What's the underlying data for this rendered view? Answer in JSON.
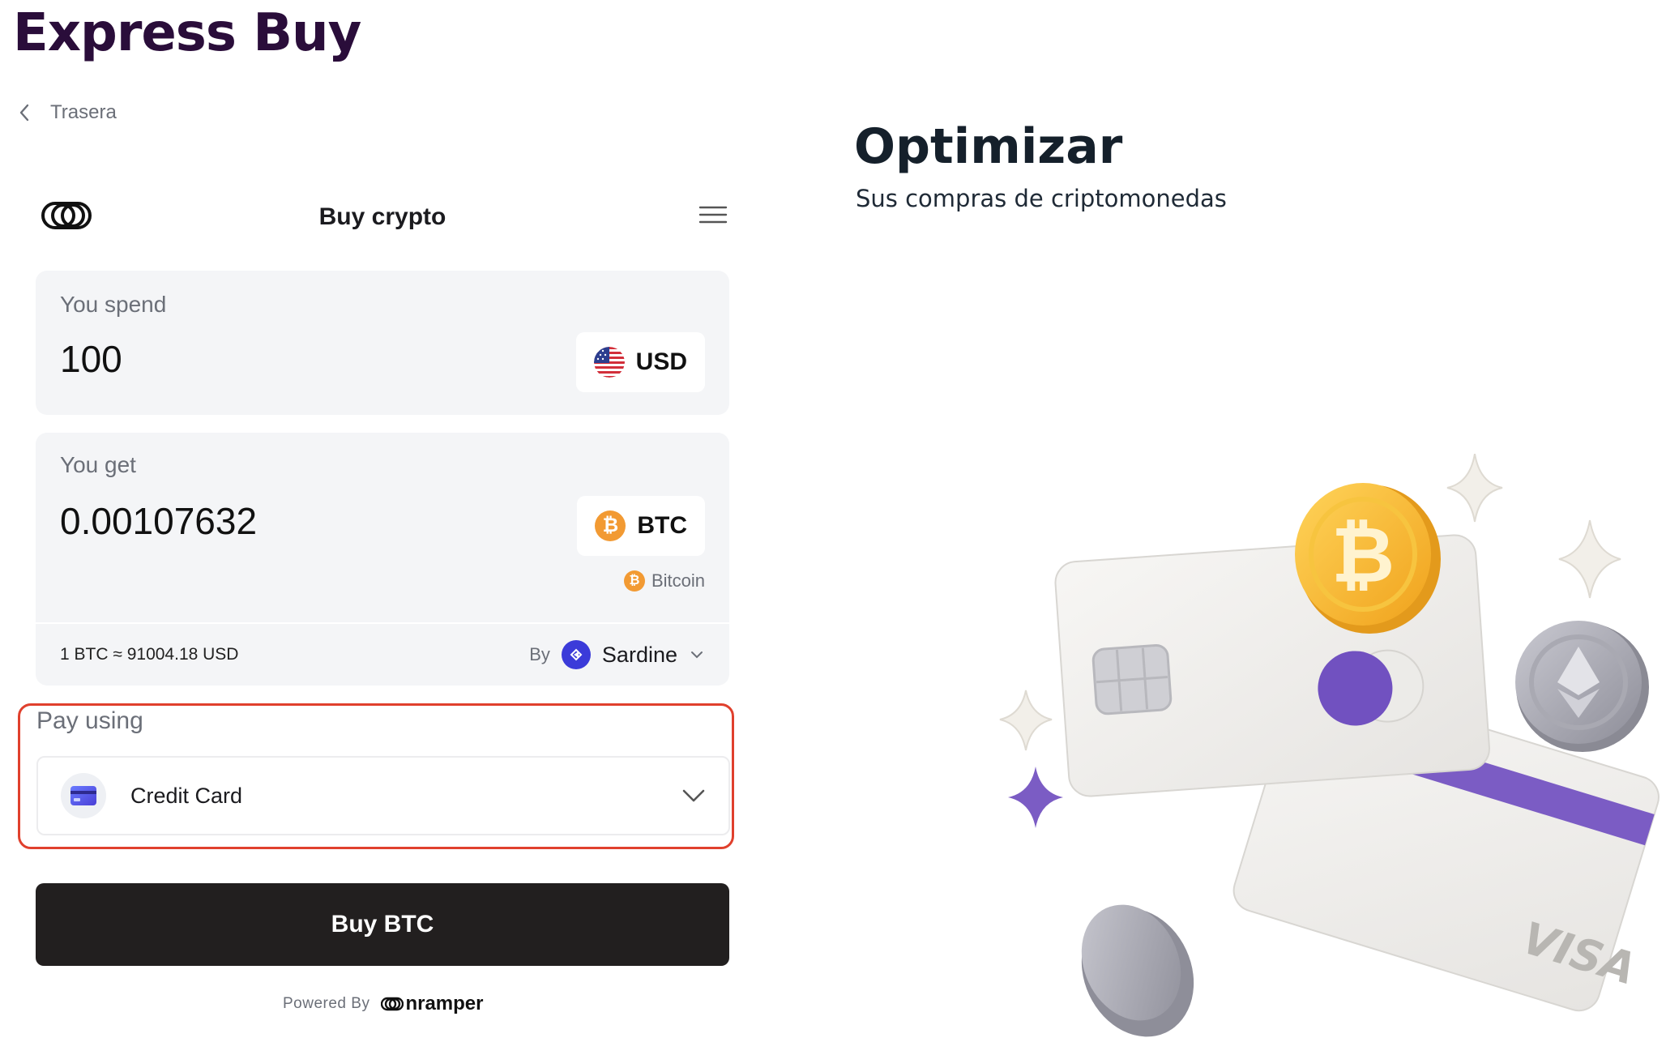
{
  "page": {
    "title": "Express Buy",
    "back_label": "Trasera"
  },
  "widget": {
    "title": "Buy crypto",
    "spend": {
      "label": "You spend",
      "amount": "100",
      "currency": "USD",
      "currency_icon": "us-flag-icon"
    },
    "get": {
      "label": "You get",
      "amount": "0.00107632",
      "currency": "BTC",
      "currency_icon": "bitcoin-icon",
      "currency_symbol": "₿",
      "network": "Bitcoin"
    },
    "rate": {
      "text": "1 BTC ≈ 91004.18 USD",
      "by_label": "By",
      "provider": "Sardine"
    },
    "payment": {
      "label": "Pay using",
      "selected": "Credit Card",
      "highlight_color": "#e0402d"
    },
    "buy_button_label": "Buy BTC",
    "powered_by_label": "Powered By",
    "powered_by_brand": "nramper"
  },
  "hero": {
    "title": "Optimizar",
    "subtitle": "Sus compras de criptomonedas",
    "illustration_label": "VISA"
  },
  "colors": {
    "brand_title": "#2a0d3a",
    "button_bg": "#221f1f",
    "card_bg": "#f4f5f7",
    "bitcoin": "#f29a33",
    "sardine": "#3b3bd9",
    "accent_purple": "#7b5cc4"
  }
}
